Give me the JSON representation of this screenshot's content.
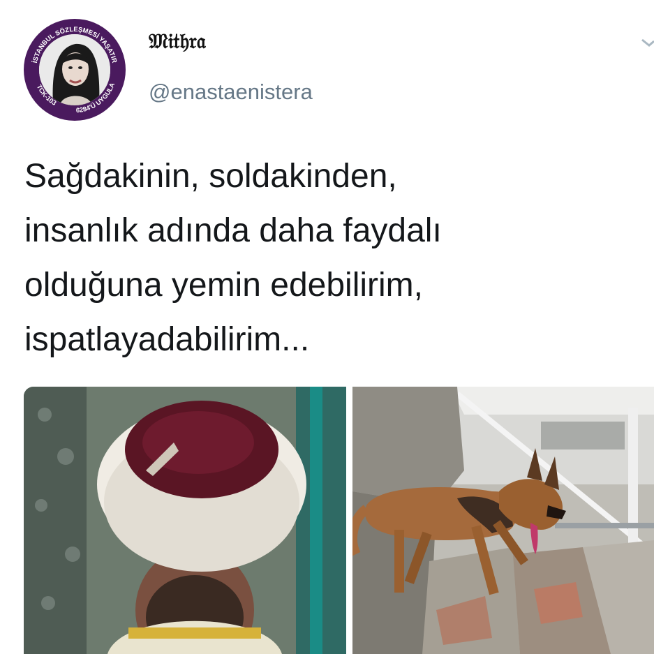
{
  "tweet": {
    "author": {
      "display_name": "𝔐𝔦𝔱𝔥𝔯𝔞",
      "handle": "@enastaenistera",
      "avatar_badge_text": {
        "top": "İSTANBUL SÖZLEŞMESİ YAŞATIR",
        "bottom_left": "TCK-103",
        "bottom_right": "6284'Ü UYGULA"
      }
    },
    "text": "Sağdakinin, soldakinden,\ninsanlık adında daha faydalı\nolduğuna yemin edebilirim,\nispatlayadabilirim...",
    "media": [
      {
        "description_icon": "imam-photo"
      },
      {
        "description_icon": "rescue-dog-photo"
      }
    ]
  },
  "icons": {
    "more": "chevron-down-icon"
  },
  "colors": {
    "text": "#14171a",
    "handle": "#657786",
    "badge": "#4a1a5e"
  }
}
